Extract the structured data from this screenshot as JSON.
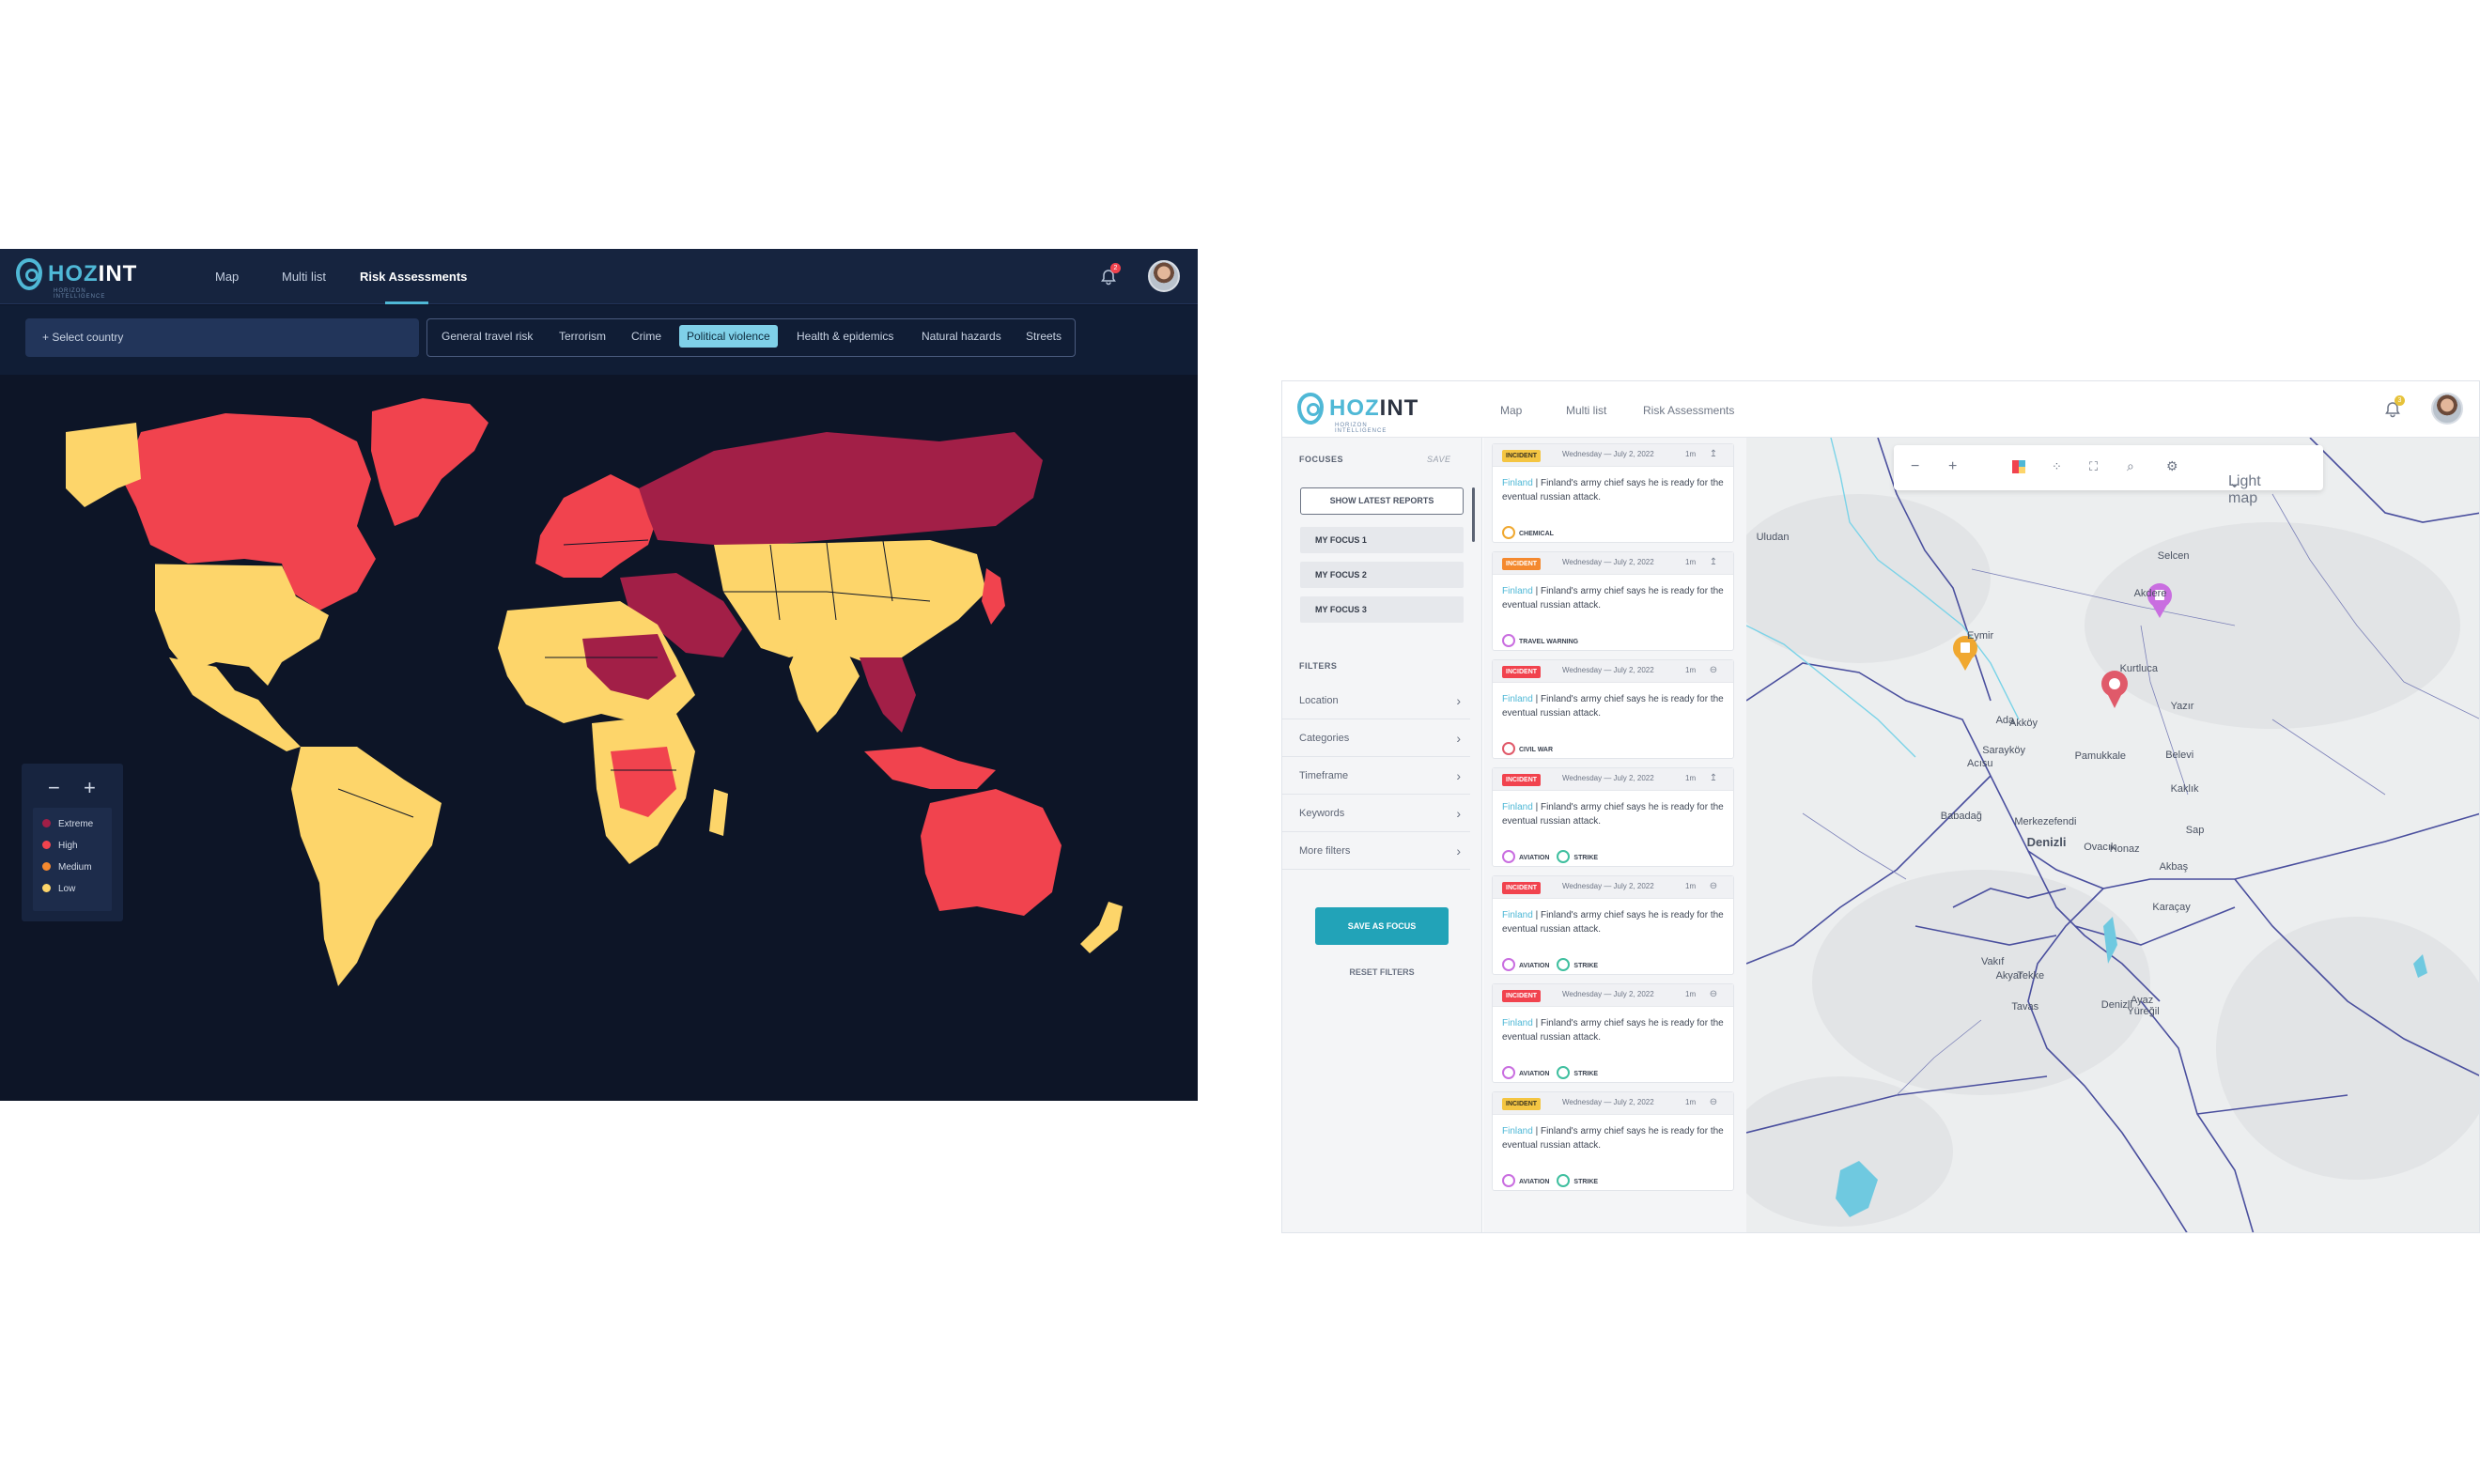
{
  "colors": {
    "extreme": "#a21f47",
    "high": "#f1434e",
    "medium": "#f4892f",
    "low": "#fdd56a",
    "accent": "#4fb8d6",
    "dark_bg": "#0d1527"
  },
  "dark_app": {
    "logo": {
      "part1": "HOZ",
      "part2": "INT",
      "tagline": "HORIZON INTELLIGENCE"
    },
    "nav": [
      "Map",
      "Multi list",
      "Risk Assessments"
    ],
    "active_nav": "Risk Assessments",
    "notification_count": "2",
    "select_country": "+ Select country",
    "categories": [
      "General travel risk",
      "Terrorism",
      "Crime",
      "Political violence",
      "Health & epidemics",
      "Natural hazards",
      "Streets"
    ],
    "selected_category": "Political violence",
    "zoom_out": "−",
    "zoom_in": "+",
    "legend": [
      "Extreme",
      "High",
      "Medium",
      "Low"
    ]
  },
  "light_app": {
    "logo": {
      "part1": "HOZ",
      "part2": "INT",
      "tagline": "HORIZON INTELLIGENCE"
    },
    "nav": [
      "Map",
      "Multi list",
      "Risk Assessments"
    ],
    "notification_count": "3",
    "sidebar": {
      "focuses_title": "FOCUSES",
      "save_link": "SAVE",
      "show_latest": "SHOW LATEST REPORTS",
      "focuses": [
        "MY FOCUS 1",
        "MY FOCUS 2",
        "MY FOCUS 3"
      ],
      "filters_title": "FILTERS",
      "filters": [
        "Location",
        "Categories",
        "Timeframe",
        "Keywords",
        "More filters"
      ],
      "save_as_focus": "SAVE AS FOCUS",
      "reset_filters": "RESET FILTERS"
    },
    "feed": [
      {
        "tag": "INCIDENT",
        "tag_color": "#f4c542",
        "date": "Wednesday — July 2, 2022",
        "ago": "1m",
        "place": "Finland",
        "text": " | Finland's army chief says he is ready for the eventual russian attack.",
        "chips": [
          {
            "label": "CHEMICAL",
            "color": "#f0a830"
          }
        ]
      },
      {
        "tag": "INCIDENT",
        "tag_color": "#f4892f",
        "date": "Wednesday — July 2, 2022",
        "ago": "1m",
        "place": "Finland",
        "text": " | Finland's army chief says he is ready for the eventual russian attack.",
        "chips": [
          {
            "label": "TRAVEL WARNING",
            "color": "#c96ee0"
          }
        ]
      },
      {
        "tag": "INCIDENT",
        "tag_color": "#f1434e",
        "date": "Wednesday — July 2, 2022",
        "ago": "1m",
        "place": "Finland",
        "text": " | Finland's army chief says he is ready for the eventual russian attack.",
        "chips": [
          {
            "label": "CIVIL WAR",
            "color": "#e05a6a"
          }
        ]
      },
      {
        "tag": "INCIDENT",
        "tag_color": "#f1434e",
        "date": "Wednesday — July 2, 2022",
        "ago": "1m",
        "place": "Finland",
        "text": " | Finland's army chief says he is ready for the eventual russian attack.",
        "chips": [
          {
            "label": "AVIATION",
            "color": "#c96ee0"
          },
          {
            "label": "STRIKE",
            "color": "#3fbf9f"
          }
        ]
      },
      {
        "tag": "INCIDENT",
        "tag_color": "#f1434e",
        "date": "Wednesday — July 2, 2022",
        "ago": "1m",
        "place": "Finland",
        "text": " | Finland's army chief says he is ready for the eventual russian attack.",
        "chips": [
          {
            "label": "AVIATION",
            "color": "#c96ee0"
          },
          {
            "label": "STRIKE",
            "color": "#3fbf9f"
          }
        ]
      },
      {
        "tag": "INCIDENT",
        "tag_color": "#f1434e",
        "date": "Wednesday — July 2, 2022",
        "ago": "1m",
        "place": "Finland",
        "text": " | Finland's army chief says he is ready for the eventual russian attack.",
        "chips": [
          {
            "label": "AVIATION",
            "color": "#c96ee0"
          },
          {
            "label": "STRIKE",
            "color": "#3fbf9f"
          }
        ]
      },
      {
        "tag": "INCIDENT",
        "tag_color": "#f4c542",
        "date": "Wednesday — July 2, 2022",
        "ago": "1m",
        "place": "Finland",
        "text": " | Finland's army chief says he is ready for the eventual russian attack.",
        "chips": [
          {
            "label": "AVIATION",
            "color": "#c96ee0"
          },
          {
            "label": "STRIKE",
            "color": "#3fbf9f"
          }
        ]
      }
    ],
    "map_toolbar": {
      "style": "Light map"
    },
    "map_labels": [
      "Selcen",
      "Akdere",
      "Eymir",
      "Kurtluca",
      "Yazır",
      "Ada",
      "Akköy",
      "Pamukkale",
      "Belevi",
      "Sarayköy",
      "Acısu",
      "Babadağ",
      "Merkezefendi",
      "Denizli",
      "Ovacık",
      "Honaz",
      "Kaklık",
      "Akbaş",
      "Karaçay",
      "Vakıf",
      "Akyar",
      "Tekke",
      "Ayaz",
      "Yüreğil",
      "Denizli",
      "Tavas",
      "Uludan",
      "Sap"
    ]
  }
}
